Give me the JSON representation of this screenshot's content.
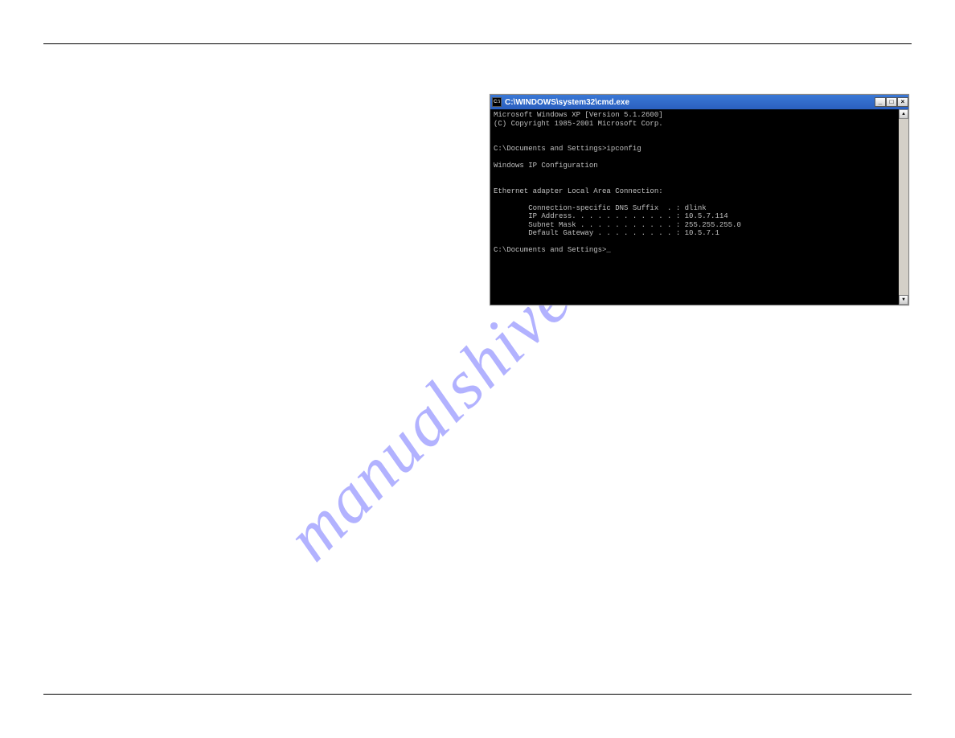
{
  "watermark": "manualshive.com",
  "window": {
    "title": "C:\\WINDOWS\\system32\\cmd.exe",
    "icon_label": "C:\\",
    "content": "Microsoft Windows XP [Version 5.1.2600]\n(C) Copyright 1985-2001 Microsoft Corp.\n\n\nC:\\Documents and Settings>ipconfig\n\nWindows IP Configuration\n\n\nEthernet adapter Local Area Connection:\n\n        Connection-specific DNS Suffix  . : dlink\n        IP Address. . . . . . . . . . . . : 10.5.7.114\n        Subnet Mask . . . . . . . . . . . : 255.255.255.0\n        Default Gateway . . . . . . . . . : 10.5.7.1\n\nC:\\Documents and Settings>_"
  },
  "buttons": {
    "minimize": "_",
    "maximize": "□",
    "close": "×"
  },
  "scrollbar": {
    "up": "▲",
    "down": "▼"
  }
}
